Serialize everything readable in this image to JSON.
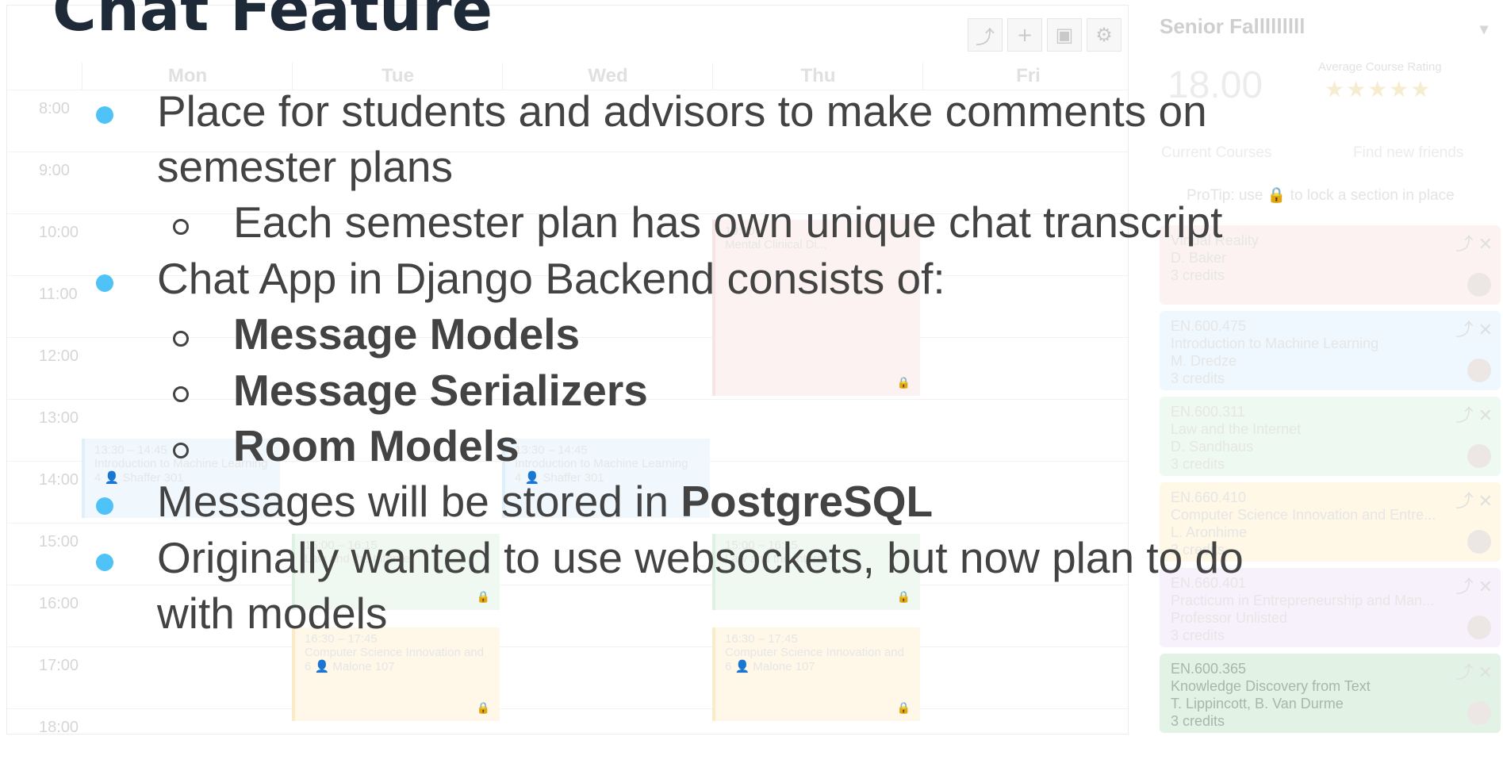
{
  "slide": {
    "title": "Chat Feature",
    "bullets": [
      {
        "line1": "Place for students and advisors to make comments on",
        "line2": "semester plans"
      },
      {
        "sub": "Each semester plan has own unique chat transcript"
      },
      {
        "text": "Chat App in Django Backend consists of:"
      },
      {
        "sub_bold": "Message Models"
      },
      {
        "sub_bold": "Message Serializers"
      },
      {
        "sub_bold": "Room Models"
      },
      {
        "prefix": "Messages will be stored in ",
        "bold": "PostgreSQL"
      },
      {
        "line1": "Originally wanted to use websockets, but now plan to do",
        "line2": "with models"
      }
    ],
    "colors": {
      "bullet": "#4fc3f7",
      "text": "#434343",
      "title": "#1e2a38"
    }
  },
  "background_app": {
    "toolbar_icons": [
      "share-icon",
      "plus-icon",
      "save-icon",
      "gear-icon"
    ],
    "days": [
      "Mon",
      "Tue",
      "Wed",
      "Thu",
      "Fri"
    ],
    "hours": [
      "8:00",
      "9:00",
      "10:00",
      "11:00",
      "12:00",
      "13:00",
      "14:00",
      "15:00",
      "16:00",
      "17:00",
      "18:00"
    ],
    "events": [
      {
        "time": "13:30 – 14:45",
        "title": "Introduction to Machine Learning",
        "room": "4 👤 Shaffer 301"
      },
      {
        "time": "13:30 – 14:45",
        "title": "Introduction to Machine Learning",
        "room": "4 👤 Shaffer 301"
      },
      {
        "time": "10:00",
        "title": "Mental Clinical Di..."
      },
      {
        "time": "15:00 – 16:15",
        "title": "Law and the Internet"
      },
      {
        "time": "15:00 – 16:15",
        "title": "Law and the Internet"
      },
      {
        "time": "16:30 – 17:45",
        "title": "Computer Science Innovation and",
        "room": "6 👤 Malone 107"
      },
      {
        "time": "16:30 – 17:45",
        "title": "Computer Science Innovation and",
        "room": "6 👤 Malone 107"
      }
    ],
    "side": {
      "semester": "Senior Falllllllll",
      "credits": "18.00",
      "rating_label": "Average Course Rating",
      "tabs": [
        "Current Courses",
        "Find new friends"
      ],
      "protip": "ProTip: use 🔒 to lock a section in place",
      "courses": [
        {
          "code": "",
          "name": "Virtual Reality",
          "prof": "D. Baker",
          "credits": "3 credits"
        },
        {
          "code": "EN.600.475",
          "name": "Introduction to Machine Learning",
          "prof": "M. Dredze",
          "credits": "3 credits"
        },
        {
          "code": "EN.600.311",
          "name": "Law and the Internet",
          "prof": "D. Sandhaus",
          "credits": "3 credits"
        },
        {
          "code": "EN.660.410",
          "name": "Computer Science Innovation and Entre...",
          "prof": "L. Aronhime",
          "credits": "3 credits"
        },
        {
          "code": "EN.660.401",
          "name": "Practicum in Entrepreneurship and Man...",
          "prof": "Professor Unlisted",
          "credits": "3 credits"
        },
        {
          "code": "EN.600.365",
          "name": "Knowledge Discovery from Text",
          "prof": "T. Lippincott, B. Van Durme",
          "credits": "3 credits"
        }
      ]
    }
  }
}
